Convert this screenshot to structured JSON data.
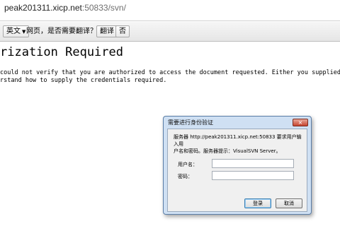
{
  "address_bar": {
    "host": "peak201311.xicp.net",
    "path": ":50833/svn/"
  },
  "translate_bar": {
    "language": "英文",
    "question": "网页，是否需要翻译？",
    "translate_button": "翻译",
    "no_button": "否"
  },
  "page": {
    "heading": "rization Required",
    "line1": "could not verify that you are authorized to access the document requested. Either you supplied the wrong",
    "line2": "rstand how to supply the credentials required."
  },
  "dialog": {
    "title": "需要进行身份验证",
    "close_glyph": "×",
    "message": "服务器 http://peak201311.xicp.net:50833 要求用户输入用\n户名和密码。服务器提示：VisualSVN Server。",
    "username_label": "用户名：",
    "password_label": "密码：",
    "username_value": "",
    "password_value": "",
    "login_button": "登录",
    "cancel_button": "取消"
  },
  "colors": {
    "dialog_frame": "#cfe0f3",
    "close_button": "#c7442f",
    "url_path": "#6f6f6f"
  }
}
